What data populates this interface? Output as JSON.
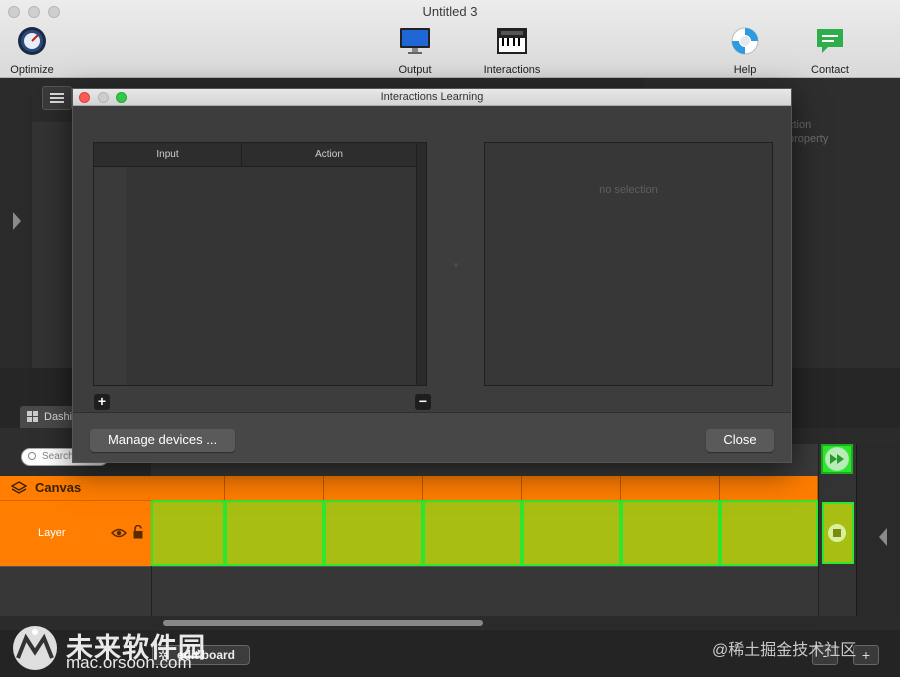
{
  "window": {
    "title": "Untitled 3"
  },
  "toolbar": {
    "optimize_label": "Optimize",
    "output_label": "Output",
    "interactions_label": "Interactions",
    "help_label": "Help",
    "contact_label": "Contact"
  },
  "background": {
    "right_panel_text_1": "ction",
    "right_panel_text_2": "property",
    "dashboard_tab_label": "Dashi",
    "search_placeholder": "Search"
  },
  "layers": {
    "canvas_label": "Canvas",
    "layer_label": "Layer"
  },
  "bottom": {
    "edit_board_label": "edit board",
    "minus_label": "-",
    "plus_label": "+"
  },
  "dialog": {
    "title": "Interactions Learning",
    "columns": {
      "input": "Input",
      "action": "Action"
    },
    "detail_placeholder": "no selection",
    "add_label": "+",
    "remove_label": "−",
    "manage_devices_label": "Manage devices ...",
    "close_label": "Close"
  },
  "watermark": {
    "brand_cn": "未来软件园",
    "url": "mac.orsoon.com",
    "right_text": "@稀土掘金技术社区"
  },
  "colors": {
    "accent_orange": "#ff7d00",
    "clip_green": "#a8be12",
    "clip_border": "#2ee62e"
  }
}
